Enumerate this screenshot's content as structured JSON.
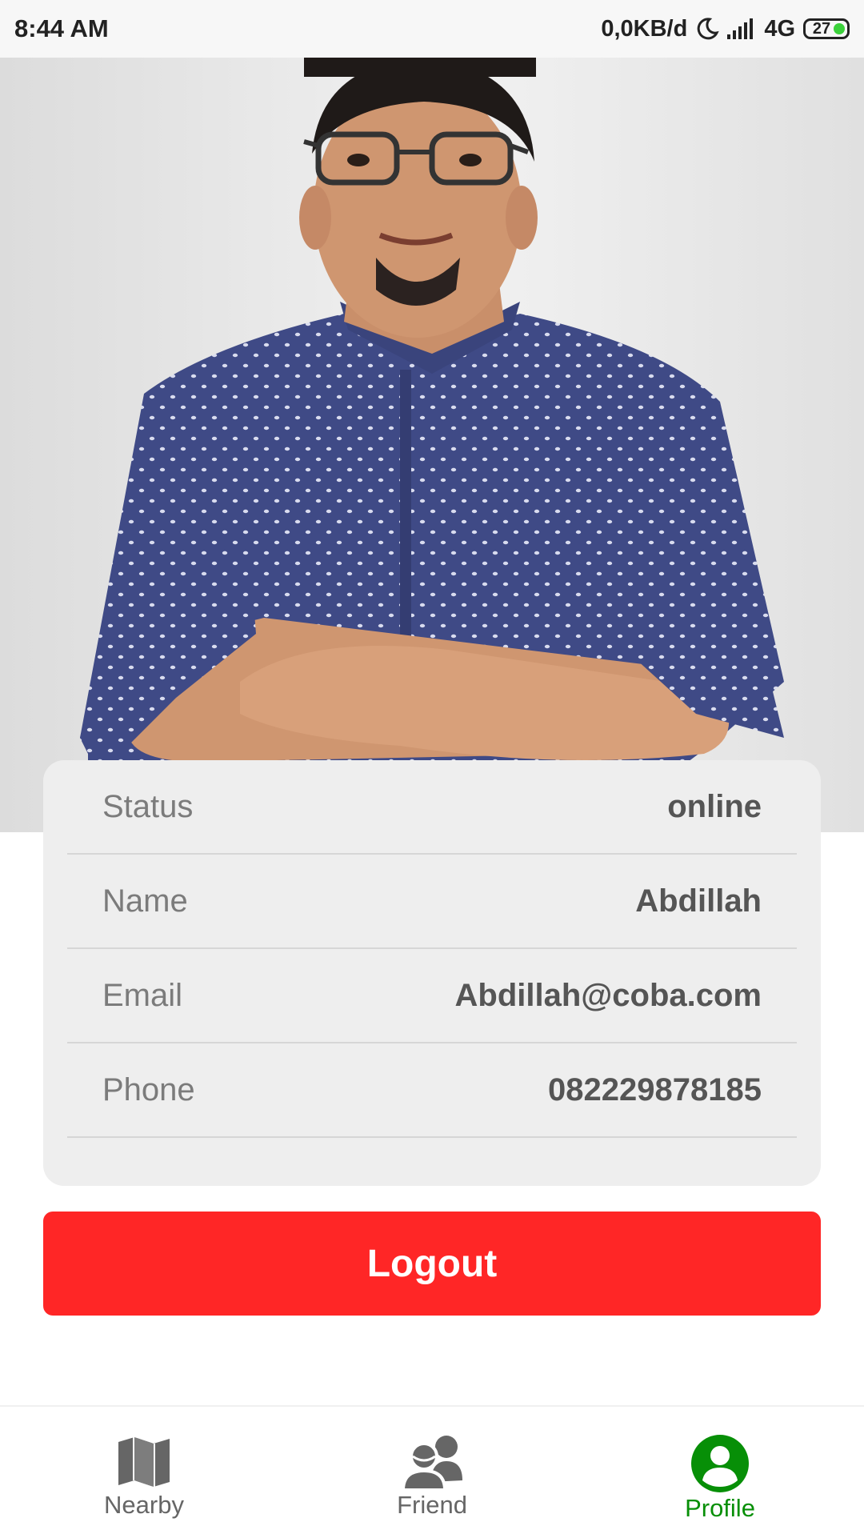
{
  "status_bar": {
    "time": "8:44 AM",
    "data_rate": "0,0KB/d",
    "network": "4G",
    "battery": "27",
    "icons": [
      "moon-icon",
      "signal-icon",
      "battery-icon"
    ]
  },
  "profile": {
    "photo_icon": "profile-photo",
    "fields": [
      {
        "label": "Status",
        "value": "online"
      },
      {
        "label": "Name",
        "value": "Abdillah"
      },
      {
        "label": "Email",
        "value": "Abdillah@coba.com"
      },
      {
        "label": "Phone",
        "value": "082229878185"
      }
    ],
    "logout_label": "Logout"
  },
  "nav": {
    "items": [
      {
        "label": "Nearby",
        "icon": "map-icon"
      },
      {
        "label": "Friend",
        "icon": "friends-icon"
      },
      {
        "label": "Profile",
        "icon": "profile-icon",
        "active": true
      }
    ]
  },
  "colors": {
    "accent": "#078f07",
    "logout": "#ff2626",
    "card": "#eeeeee"
  }
}
